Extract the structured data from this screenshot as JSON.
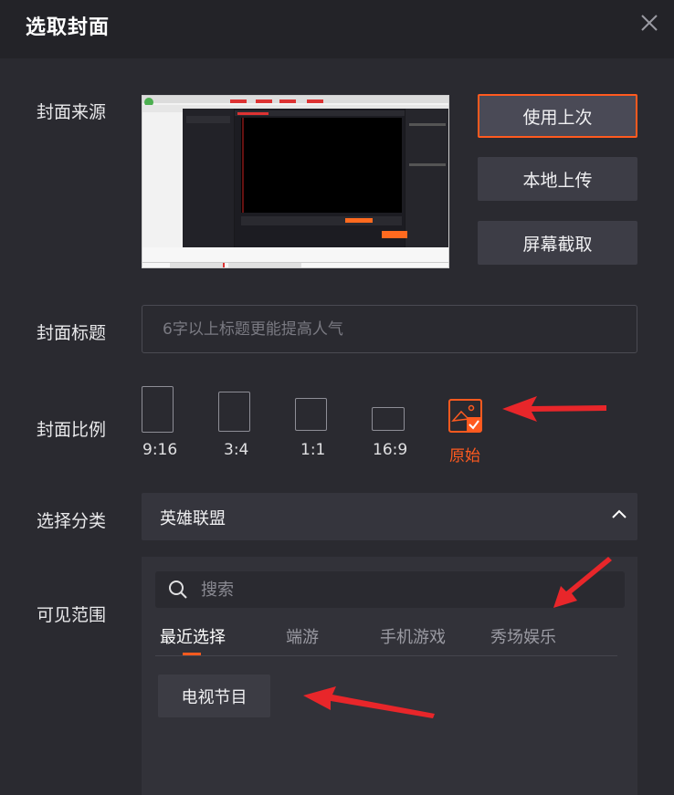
{
  "dialog": {
    "title": "选取封面"
  },
  "labels": {
    "source": "封面来源",
    "cover_title": "封面标题",
    "ratio": "封面比例",
    "category": "选择分类",
    "visibility": "可见范围"
  },
  "source_buttons": {
    "use_last": "使用上次",
    "local_upload": "本地上传",
    "screen_capture": "屏幕截取"
  },
  "title_input": {
    "placeholder": "6字以上标题更能提高人气",
    "value": ""
  },
  "ratios": [
    {
      "label": "9:16"
    },
    {
      "label": "3:4"
    },
    {
      "label": "1:1"
    },
    {
      "label": "16:9"
    },
    {
      "label": "原始",
      "selected": true
    }
  ],
  "category": {
    "selected": "英雄联盟"
  },
  "search": {
    "placeholder": "搜索"
  },
  "tabs": [
    "最近选择",
    "端游",
    "手机游戏",
    "秀场娱乐"
  ],
  "chips": [
    "电视节目"
  ],
  "colors": {
    "accent": "#ff5a1f",
    "background": "#2a2a30",
    "header": "#232328",
    "arrow": "#e8262a"
  }
}
